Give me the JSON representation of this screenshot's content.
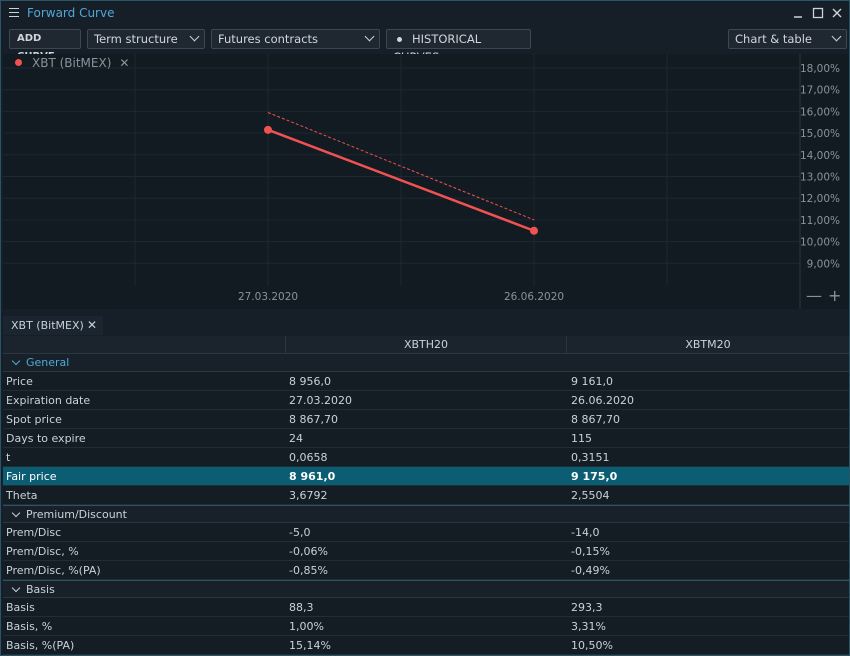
{
  "window": {
    "title": "Forward Curve"
  },
  "toolbar": {
    "add_curve": "ADD CURVE",
    "term_structure": "Term structure",
    "futures": "Futures contracts",
    "historical": "HISTORICAL CURVES",
    "view_mode": "Chart & table"
  },
  "chart": {
    "legend_label": "XBT (BitMEX)",
    "close_glyph": "✕",
    "zoom_out": "—",
    "zoom_in": "+"
  },
  "chart_data": {
    "type": "line",
    "x": [
      "27.03.2020",
      "26.06.2020"
    ],
    "series": [
      {
        "values": [
          15.15,
          10.5
        ],
        "style": "solid",
        "color": "#f05252"
      },
      {
        "values": [
          15.95,
          11.0
        ],
        "style": "dashed",
        "color": "#f05252"
      }
    ],
    "y_ticks": [
      "18,00%",
      "17,00%",
      "16,00%",
      "15,00%",
      "14,00%",
      "13,00%",
      "12,00%",
      "11,00%",
      "10,00%",
      "9,00%"
    ],
    "ylim": [
      8.4,
      18.3
    ],
    "grid": true
  },
  "tabs": [
    {
      "label": "XBT (BitMEX)",
      "close": "✕"
    }
  ],
  "table": {
    "columns": [
      "XBTH20",
      "XBTM20"
    ],
    "groups": [
      {
        "label": "General",
        "rows": [
          {
            "label": "Price",
            "v1": "8 956,0",
            "v2": "9 161,0"
          },
          {
            "label": "Expiration date",
            "v1": "27.03.2020",
            "v2": "26.06.2020"
          },
          {
            "label": "Spot price",
            "v1": "8 867,70",
            "v2": "8 867,70"
          },
          {
            "label": "Days to expire",
            "v1": "24",
            "v2": "115"
          },
          {
            "label": "t",
            "v1": "0,0658",
            "v2": "0,3151"
          },
          {
            "label": "Fair price",
            "v1": "8 961,0",
            "v2": "9 175,0"
          },
          {
            "label": "Theta",
            "v1": "3,6792",
            "v2": "2,5504"
          }
        ]
      },
      {
        "label": "Premium/Discount",
        "rows": [
          {
            "label": "Prem/Disc",
            "v1": "-5,0",
            "v2": "-14,0"
          },
          {
            "label": "Prem/Disc, %",
            "v1": "-0,06%",
            "v2": "-0,15%"
          },
          {
            "label": "Prem/Disc, %(PA)",
            "v1": "-0,85%",
            "v2": "-0,49%"
          }
        ]
      },
      {
        "label": "Basis",
        "rows": [
          {
            "label": "Basis",
            "v1": "88,3",
            "v2": "293,3"
          },
          {
            "label": "Basis, %",
            "v1": "1,00%",
            "v2": "3,31%"
          },
          {
            "label": "Basis, %(PA)",
            "v1": "15,14%",
            "v2": "10,50%"
          }
        ]
      }
    ]
  }
}
